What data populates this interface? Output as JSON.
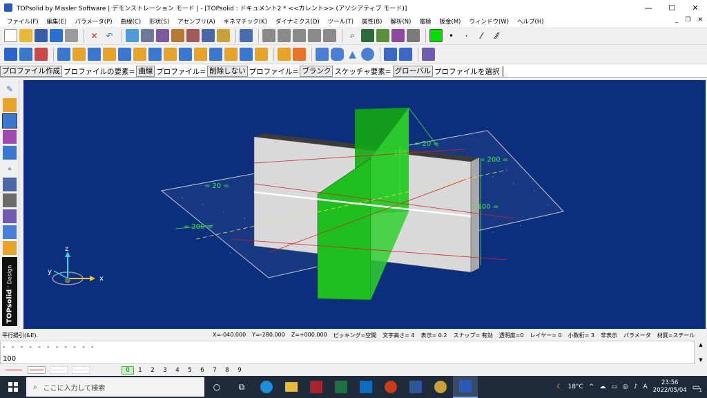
{
  "window": {
    "title": "TOPsolid by Missler Software | デモンストレーション モード | - [TOPsolid : ドキュメント2 *  <<カレント>> (アソシアティブ モード)]"
  },
  "window_controls": {
    "minimize": "—",
    "maximize": "☐",
    "close": "✕"
  },
  "menu": {
    "items": [
      "ファイル(F)",
      "編集(E)",
      "パラメータ(P)",
      "曲線(C)",
      "形状(S)",
      "アセンブリ(A)",
      "キネマチック(K)",
      "ダイナミクス(D)",
      "ツール(T)",
      "属性(B)",
      "解析(N)",
      "電極",
      "板金(M)",
      "ウィンドウ(W)",
      "ヘルプ(H)"
    ],
    "mdi_min": "_",
    "mdi_restore": "❐",
    "mdi_close": "✕"
  },
  "cmdbar": {
    "l1": "プロファイル作成",
    "l2": "プロファイルの要素=",
    "b1": "曲線",
    "l3": "プロファイル=",
    "b2": "削除しない",
    "l4": "プロファイル=",
    "b3": "ブランク",
    "l5": "スケッチャ要素=",
    "b4": "グローバル",
    "l6": "プロファイルを選択"
  },
  "brand": {
    "name": "TOPsolid",
    "sub": "' Design"
  },
  "viewport": {
    "dims": [
      "= 20 =",
      "= 200 =",
      "= 20 =",
      "= 200 =",
      "= 100 =",
      "100"
    ],
    "axes": {
      "x": "x",
      "y": "y",
      "z": "z"
    }
  },
  "statusbar": {
    "left": "平行掃引(&E).",
    "x": "X=-040.000",
    "y": "Y=-280.000",
    "z": "Z=+000.000",
    "snap_mode": "ピッキング=空間",
    "text_height": "文字高さ=  4",
    "display": "表示=   0.2",
    "snap": "スナップ= 有効",
    "transparency": "透明度=0",
    "layer": "レイヤー= 0",
    "decimals": "小数桁= 3",
    "hidden": "非表示",
    "params": "パラメータ",
    "material": "材質=スチール"
  },
  "messages": {
    "line1": "- - - - - - - - - - -",
    "line2": "100"
  },
  "scroll": {
    "up": "▲",
    "down": "▼"
  },
  "layers": {
    "numbers": [
      "0",
      "1",
      "2",
      "3",
      "4",
      "5",
      "6",
      "7",
      "8",
      "9"
    ]
  },
  "taskbar": {
    "search_placeholder": "ここに入力して検索",
    "search_icon": "⌕",
    "cortana": "○",
    "taskview": "⧉",
    "temperature": "18°C",
    "ime": "A",
    "time": "23:56",
    "date": "2022/05/04",
    "notification_count": "1"
  },
  "colors": {
    "viewport_bg": "#0b2f7d",
    "solid_green": "#1fbf1f",
    "part_grey": "#d9d9d9",
    "accent_line": "#d22222"
  }
}
